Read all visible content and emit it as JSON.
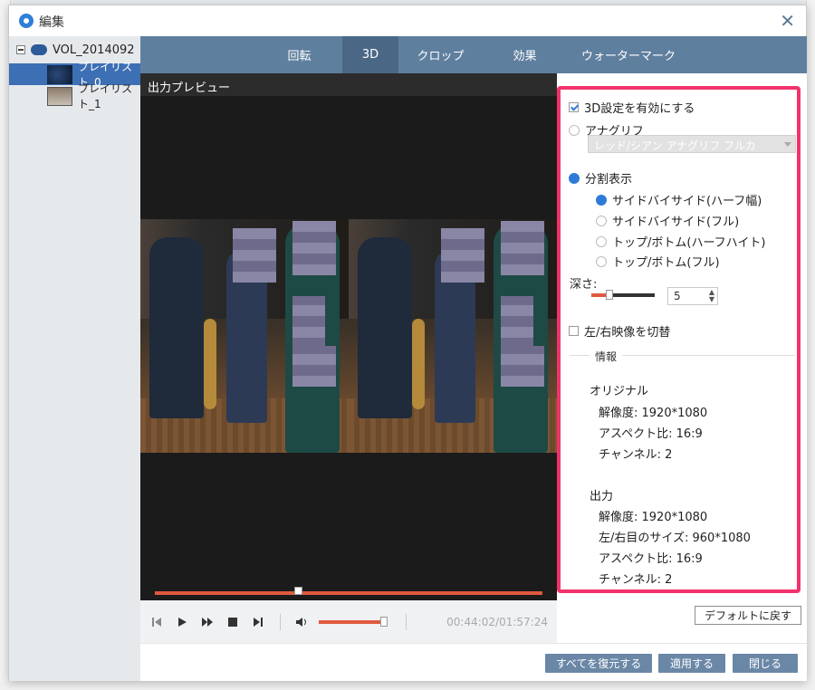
{
  "window": {
    "title": "編集",
    "close_glyph": "✕"
  },
  "tree": {
    "root_label": "VOL_2014092",
    "items": [
      {
        "label": "プレイリスト_0"
      },
      {
        "label": "プレイリスト_1"
      }
    ]
  },
  "tabs": [
    {
      "label": "回転"
    },
    {
      "label": "3D"
    },
    {
      "label": "クロップ"
    },
    {
      "label": "効果"
    },
    {
      "label": "ウォーターマーク"
    }
  ],
  "active_tab": "3D",
  "preview": {
    "title": "出力プレビュー",
    "seek_fraction": 0.37,
    "time": "00:44:02/01:57:24",
    "volume_fraction": 1.0
  },
  "settings": {
    "enable_3d_label": "3D設定を有効にする",
    "enable_3d_checked": true,
    "anaglyph_label": "アナグリフ",
    "anaglyph_select_value": "レッド/シアン アナグリフ フルカ",
    "split_label": "分割表示",
    "split_options": [
      "サイドバイサイド(ハーフ幅)",
      "サイドバイサイド(フル)",
      "トップ/ボトム(ハーフハイト)",
      "トップ/ボトム(フル)"
    ],
    "depth_label": "深さ:",
    "depth_value": "5",
    "swap_label": "左/右映像を切替",
    "swap_checked": false,
    "info_label": "情報",
    "original_heading": "オリジナル",
    "original": [
      "解像度: 1920*1080",
      "アスペクト比: 16:9",
      "チャンネル: 2"
    ],
    "output_heading": "出力",
    "output": [
      "解像度: 1920*1080",
      "左/右目のサイズ: 960*1080",
      "アスペクト比: 16:9",
      "チャンネル: 2"
    ],
    "default_button": "デフォルトに戻す"
  },
  "footer": {
    "restore_all": "すべてを復元する",
    "apply": "適用する",
    "close": "閉じる"
  },
  "colors": {
    "accent": "#2d7bd6",
    "tab_bar": "#5f7f9f",
    "highlight_frame": "#f2326b",
    "seek": "#e05a3f"
  }
}
